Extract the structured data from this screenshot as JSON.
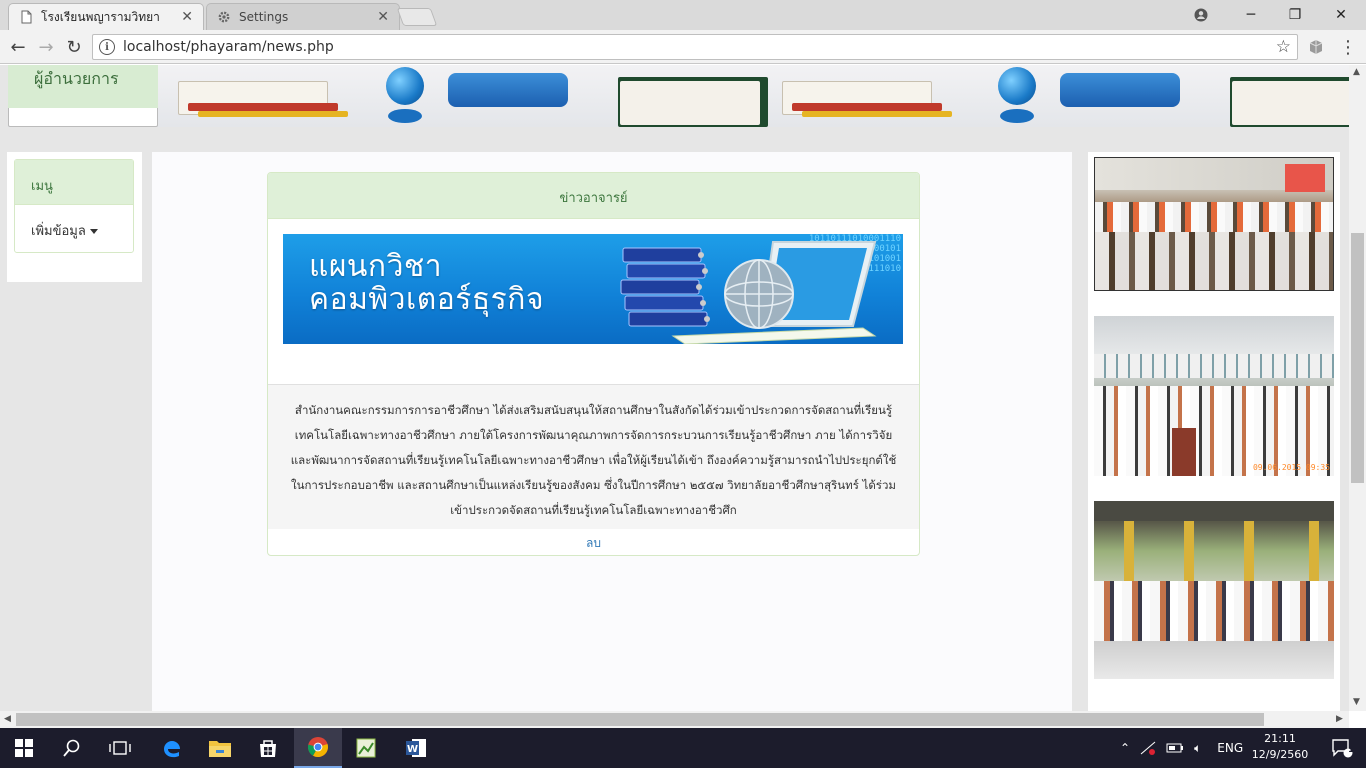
{
  "browser": {
    "tabs": [
      {
        "title": "โรงเรียนพญารามวิทยา",
        "active": true
      },
      {
        "title": "Settings",
        "active": false
      }
    ],
    "url": "localhost/phayaram/news.php"
  },
  "banner": {
    "label": "ผู้อำนวยการ"
  },
  "menu": {
    "heading": "เมนู",
    "items": [
      {
        "label": "เพิ่มข้อมูล"
      }
    ]
  },
  "news": {
    "heading": "ข่าวอาจารย์",
    "image_text_line1": "แผนกวิชา",
    "image_text_line2": "คอมพิวเตอร์ธุรกิจ",
    "body": "สำนักงานคณะกรรมการการอาชีวศึกษา ได้ส่งเสริมสนับสนุนให้สถานศึกษาในสังกัดได้ร่วมเข้าประกวดการจัดสถานที่เรียนรู้เทคโนโลยีเฉพาะทางอาชีวศึกษา ภายใต้โครงการพัฒนาคุณภาพการจัดการกระบวนการเรียนรู้อาชีวศึกษา ภาย ได้การวิจัยและพัฒนาการจัดสถานที่เรียนรู้เทคโนโลยีเฉพาะทางอาชีวศึกษา เพื่อให้ผู้เรียนได้เข้า ถึงองค์ความรู้สามารถนำไปประยุกต์ใช้ในการประกอบอาชีพ และสถานศึกษาเป็นแหล่งเรียนรู้ของสังคม ซึ่งในปีการศึกษา ๒๕๕๗ วิทยาลัยอาชีวศึกษาสุรินทร์ ได้ร่วมเข้าประกวดจัดสถานที่เรียนรู้เทคโนโลยีเฉพาะทางอาชีวศึก",
    "delete_label": "ลบ"
  },
  "photos": {
    "timestamp": "09.06.2015 09:35"
  },
  "taskbar": {
    "lang": "ENG",
    "time": "21:11",
    "date": "12/9/2560",
    "notification_count": "1"
  },
  "colors": {
    "panel_heading_bg": "#dff0d8",
    "panel_heading_text": "#3c763d",
    "link": "#337ab7",
    "taskbar": "#1c1c2c"
  }
}
